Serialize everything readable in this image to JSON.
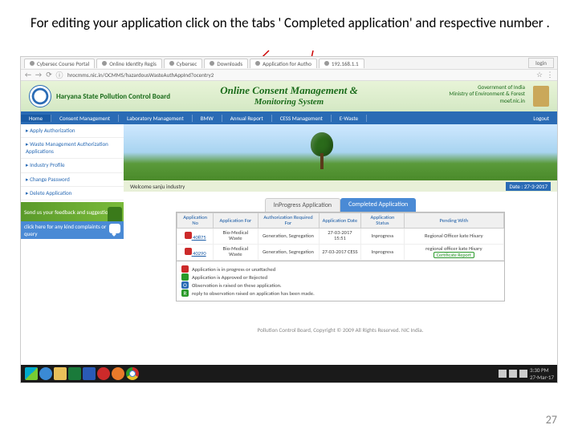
{
  "instruction": "For editing your application click on the tabs ' Completed application' and respective number .",
  "page_number": "27",
  "browser": {
    "tabs": [
      "Cybersec Course Portal",
      "Online Identity Regis",
      "Cybersec",
      "Downloads",
      "Application for Autho",
      "192.168.1.1"
    ],
    "login": "login",
    "url": "hrocmms.nic.in/OCMMS/hazardousWasteAuthAppInd?ocentry2",
    "star": "☆",
    "menu": "⋮"
  },
  "banner": {
    "board": "Haryana State Pollution Control Board",
    "title1": "Online Consent Management &",
    "title2": "Monitoring System",
    "gov1": "Government of India",
    "gov2": "Ministry of Environment & Forest",
    "gov3": "moef.nic.in"
  },
  "nav": {
    "home": "Home",
    "consent": "Consent Management",
    "lab": "Laboratory Management",
    "bmw": "BMW",
    "annual": "Annual Report",
    "cess": "CESS Management",
    "ewaste": "E-Waste",
    "logout": "Logout"
  },
  "sidebar": {
    "items": [
      "Apply Authorization",
      "Waste Management Authorization Applications",
      "Industry Profile",
      "Change Password",
      "Delete Application"
    ],
    "feedback": "Send us your feedback and suggestions",
    "complaints": "click here for any kind complaints or query"
  },
  "welcome": {
    "text": "Welcome sanju industry",
    "date": "Date : 27-3-2017"
  },
  "tabs": {
    "inprogress": "InProgress Application",
    "completed": "Completed Application"
  },
  "table": {
    "headers": [
      "Application No",
      "Application For",
      "Authorization Required For",
      "Application Date",
      "Application Status",
      "Pending With"
    ],
    "rows": [
      {
        "no": "40875",
        "for": "Bio-Medical Waste",
        "req": "Generation, Segregation",
        "date": "27-03-2017 15:51",
        "status": "Inprogress",
        "pending": "Regional Officer kate Hisary"
      },
      {
        "no": "40290",
        "for": "Bio-Medical Waste",
        "req": "Generation, Segregation",
        "date": "27-03-2017 CESS",
        "status": "Inprogress",
        "pending": "regional officer kate Hisary"
      }
    ],
    "badge": "Certificate Report"
  },
  "legend": {
    "l1": "Application is in progress or unattached",
    "l2": "Application is Approved or Rejected",
    "l3": "Observation is raised on these application.",
    "l4": "reply to observation raised on application has been made."
  },
  "footer": "Pollution Control Board, Copyright © 2009 All Rights Reserved. NIC India.",
  "taskbar": {
    "time": "3:30 PM",
    "date": "27-Mar-17"
  }
}
